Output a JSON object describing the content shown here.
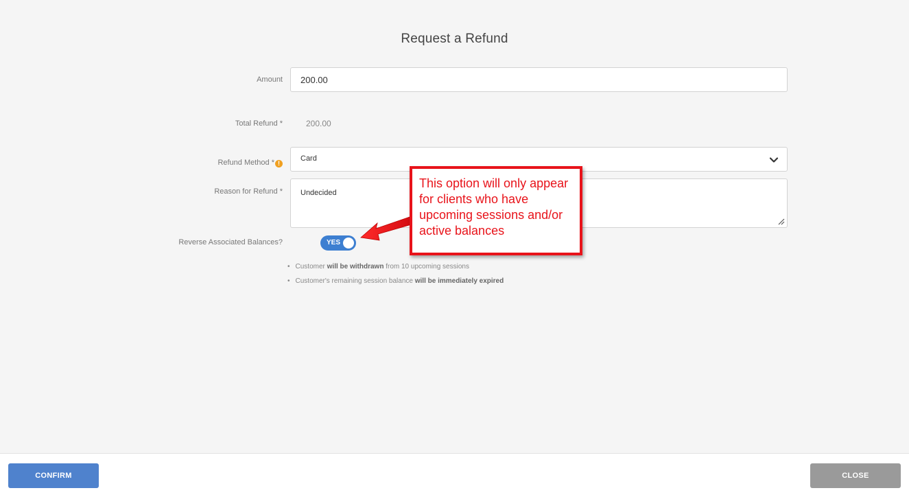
{
  "dialog": {
    "title": "Request a Refund"
  },
  "form": {
    "amount": {
      "label": "Amount",
      "value": "200.00"
    },
    "total_refund": {
      "label": "Total Refund *",
      "value": "200.00"
    },
    "refund_method": {
      "label": "Refund Method *",
      "info_icon": "info-icon",
      "value": "Card"
    },
    "reason": {
      "label": "Reason for Refund *",
      "value": "Undecided"
    },
    "reverse_balances": {
      "label": "Reverse Associated Balances?",
      "toggle_text": "YES",
      "toggle_on": true
    }
  },
  "consequences": [
    {
      "pre": "Customer ",
      "bold": "will be withdrawn",
      "post": " from 10 upcoming sessions"
    },
    {
      "pre": "Customer's remaining session balance ",
      "bold": "will be immediately expired",
      "post": ""
    }
  ],
  "callout": {
    "text": "This option will only appear for clients who have upcoming sessions and/or active balances",
    "color": "#e8131a"
  },
  "footer": {
    "confirm_label": "CONFIRM",
    "close_label": "CLOSE"
  },
  "colors": {
    "accent": "#4f82cd",
    "toggle": "#3d7fd1",
    "close": "#9a9a9a",
    "warning": "#f0a020"
  }
}
